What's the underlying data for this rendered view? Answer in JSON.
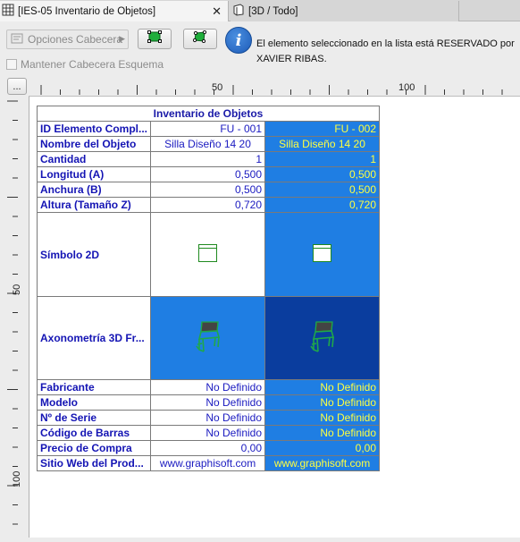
{
  "tabs": [
    {
      "label": "[IES-05 Inventario de Objetos]",
      "icon": "table-icon",
      "active": true
    },
    {
      "label": "[3D / Todo]",
      "icon": "3d-view-icon",
      "active": false
    }
  ],
  "toolbar": {
    "options_label": "Opciones Cabecera",
    "keep_header_label": "Mantener Cabecera Esquema",
    "info_message": "El elemento seleccionado en la lista está RESERVADO por XAVIER RIBAS.",
    "more_label": "..."
  },
  "ruler": {
    "h_labels": [
      "50",
      "100"
    ],
    "v_labels": [
      "50",
      "100"
    ]
  },
  "schedule": {
    "title": "Inventario de Objetos",
    "rows": [
      {
        "label": "ID Elemento Compl...",
        "v1": "FU - 001",
        "v2": "FU - 002",
        "align": "right"
      },
      {
        "label": "Nombre del Objeto",
        "v1": "Silla Diseño 14 20",
        "v2": "Silla Diseño 14 20",
        "align": "center"
      },
      {
        "label": "Cantidad",
        "v1": "1",
        "v2": "1",
        "align": "right"
      },
      {
        "label": "Longitud (A)",
        "v1": "0,500",
        "v2": "0,500",
        "align": "right"
      },
      {
        "label": "Anchura (B)",
        "v1": "0,500",
        "v2": "0,500",
        "align": "right"
      },
      {
        "label": "Altura (Tamaño Z)",
        "v1": "0,720",
        "v2": "0,720",
        "align": "right"
      }
    ],
    "symbol_label": "Símbolo 2D",
    "axon_label": "Axonometría 3D Fr...",
    "rows_bottom": [
      {
        "label": "Fabricante",
        "v1": "No Definido",
        "v2": "No Definido"
      },
      {
        "label": "Modelo",
        "v1": "No Definido",
        "v2": "No Definido"
      },
      {
        "label": "Nº de Serie",
        "v1": "No Definido",
        "v2": "No Definido"
      },
      {
        "label": "Código de Barras",
        "v1": "No Definido",
        "v2": "No Definido"
      },
      {
        "label": "Precio de Compra",
        "v1": "0,00",
        "v2": "0,00"
      },
      {
        "label": "Sitio Web del Prod...",
        "v1": "www.graphisoft.com",
        "v2": "www.graphisoft.com"
      }
    ]
  },
  "colors": {
    "selected_cell": "#1f7ee3",
    "selected_dark": "#0a3d9e",
    "selected_text": "#ffff40",
    "label_text": "#1414b4"
  }
}
